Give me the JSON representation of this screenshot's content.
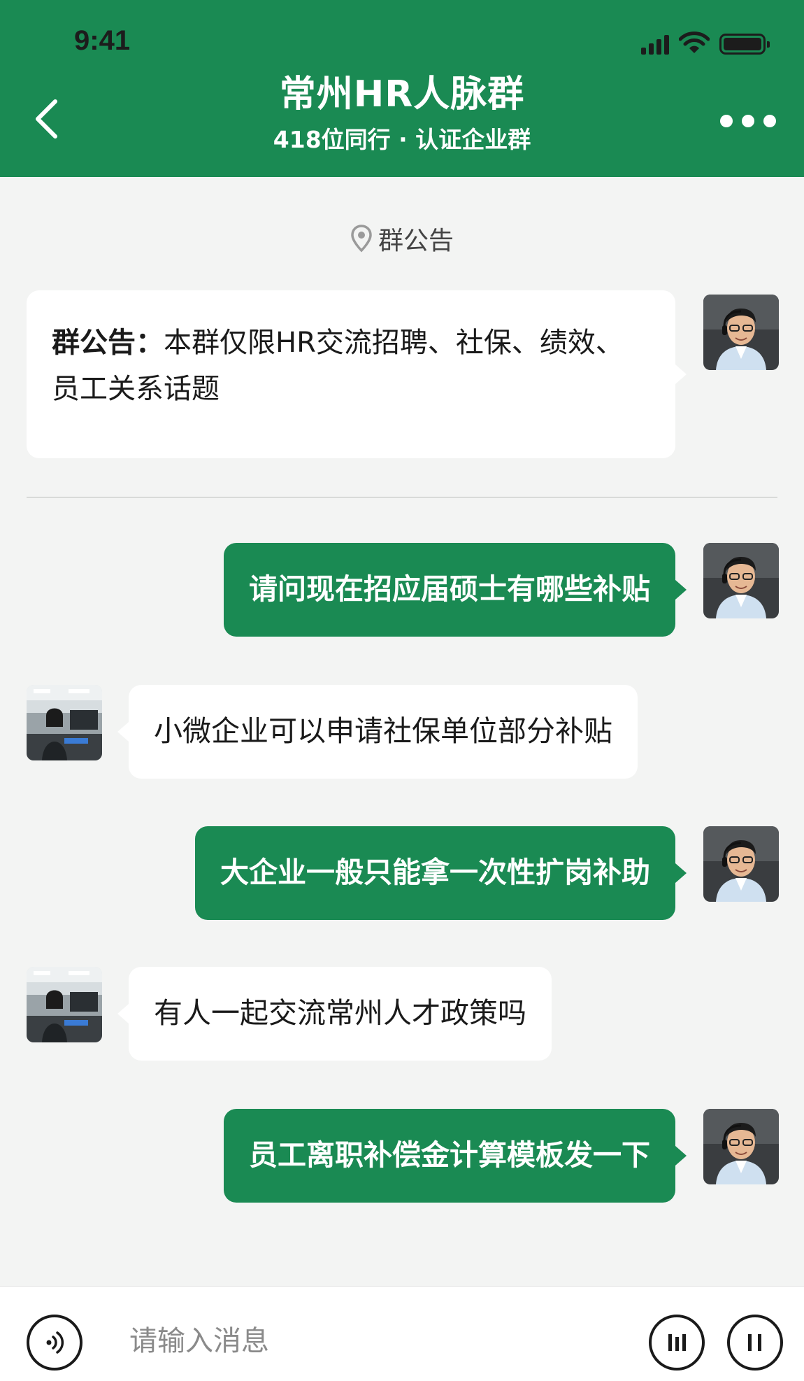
{
  "status_bar": {
    "time": "9:41",
    "icons": [
      "signal-icon",
      "wifi-icon",
      "battery-icon"
    ]
  },
  "header": {
    "title": "常州HR人脉群",
    "subtitle": "418位同行 · 认证企业群",
    "back_icon": "chevron-left-icon",
    "more_icon": "more-dots-icon"
  },
  "colors": {
    "brand_green": "#1a8a53",
    "background": "#f3f4f3",
    "bubble_white": "#ffffff"
  },
  "chat": {
    "notice_label": "群公告",
    "notice": {
      "prefix": "群公告：",
      "body": "本群仅限HR交流招聘、社保、绩效、员工关系话题"
    },
    "messages": [
      {
        "side": "right",
        "text": "请问现在招应届硕士有哪些补贴"
      },
      {
        "side": "left",
        "text": "小微企业可以申请社保单位部分补贴"
      },
      {
        "side": "right",
        "text": "大企业一般只能拿一次性扩岗补助"
      },
      {
        "side": "left",
        "text": "有人一起交流常州人才政策吗"
      },
      {
        "side": "right",
        "text": "员工离职补偿金计算模板发一下"
      }
    ]
  },
  "input_bar": {
    "placeholder": "请输入消息",
    "voice_icon": "voice-icon"
  }
}
